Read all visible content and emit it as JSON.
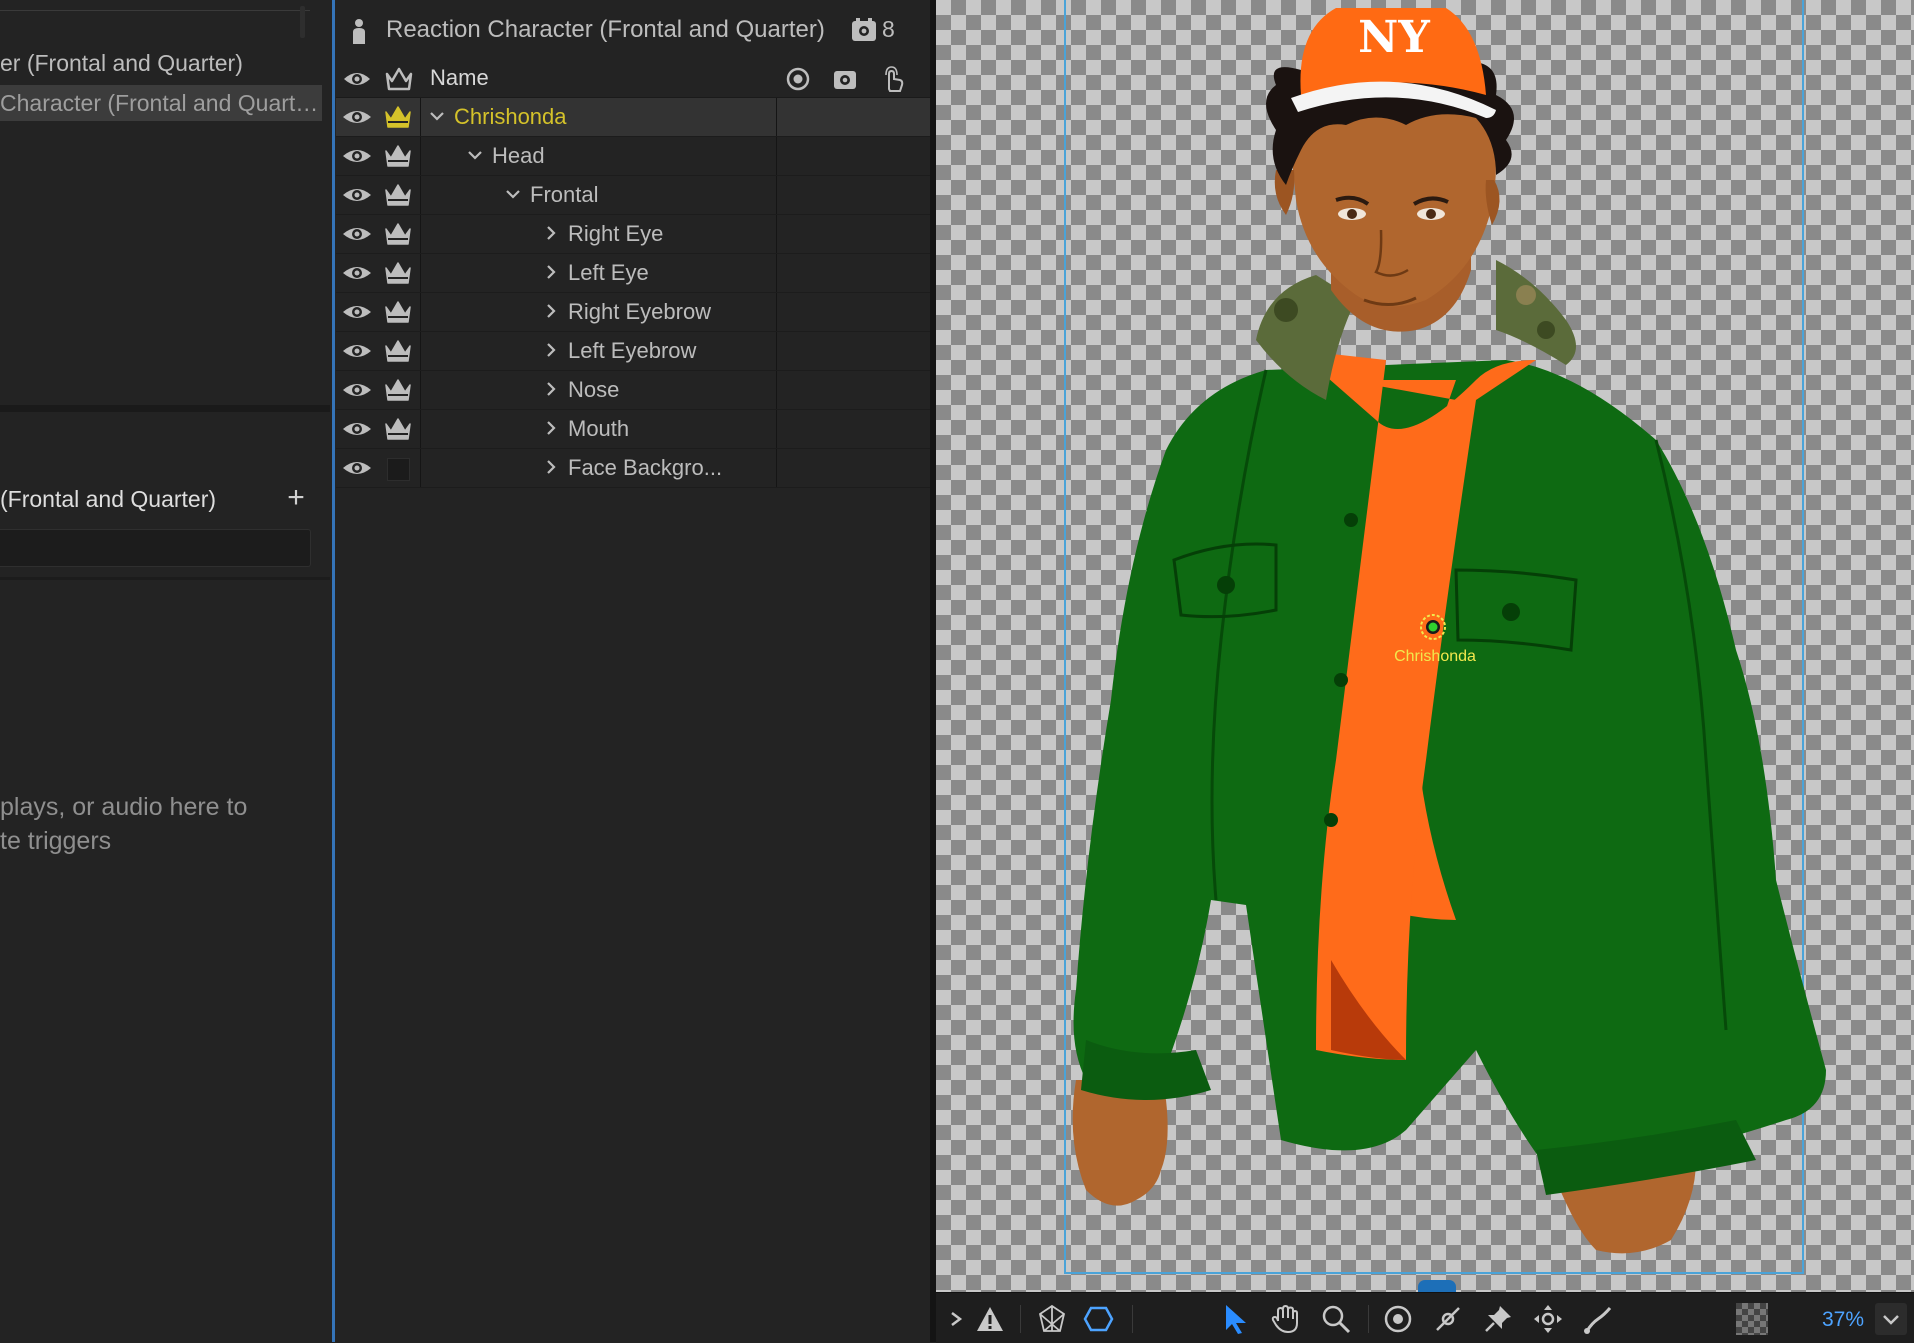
{
  "left_panel": {
    "puppet_items": [
      "er (Frontal and Quarter)",
      "Character (Frontal and Quart…"
    ],
    "trigger_title": "(Frontal and Quarter)",
    "add_button": "+",
    "drop_hint": "plays, or audio here to\nte triggers"
  },
  "layers_panel": {
    "title": "Reaction Character (Frontal and Quarter)",
    "count": "8",
    "column_name": "Name",
    "rows": [
      {
        "label": "Chrishonda",
        "depth": 0,
        "chevron": "down",
        "selected": true,
        "crown": true
      },
      {
        "label": "Head",
        "depth": 1,
        "chevron": "down",
        "crown": true
      },
      {
        "label": "Frontal",
        "depth": 2,
        "chevron": "down",
        "crown": true
      },
      {
        "label": "Right Eye",
        "depth": 3,
        "chevron": "right",
        "crown": true
      },
      {
        "label": "Left Eye",
        "depth": 3,
        "chevron": "right",
        "crown": true
      },
      {
        "label": "Right Eyebrow",
        "depth": 3,
        "chevron": "right",
        "crown": true
      },
      {
        "label": "Left Eyebrow",
        "depth": 3,
        "chevron": "right",
        "crown": true
      },
      {
        "label": "Nose",
        "depth": 3,
        "chevron": "right",
        "crown": true
      },
      {
        "label": "Mouth",
        "depth": 3,
        "chevron": "right",
        "crown": true
      },
      {
        "label": "Face Backgro...",
        "depth": 3,
        "chevron": "right",
        "crown": false
      }
    ]
  },
  "canvas": {
    "origin_label": "Chrishonda",
    "colors": {
      "artboard_border": "#4aa3d8",
      "selection": "#d4c22a",
      "jacket": "#0f6e12",
      "shirt": "#ff6b1a",
      "cap": "#ff6a13"
    }
  },
  "toolbar": {
    "zoom": "37%",
    "icons": [
      "expand-chevron-icon",
      "warning-icon",
      "mesh-icon",
      "outline-icon",
      "select-arrow-icon",
      "hand-icon",
      "zoom-icon",
      "origin-icon",
      "handle-icon",
      "pin-icon",
      "dragger-icon",
      "stick-icon",
      "transparency-grid-icon",
      "zoom-dropdown-icon"
    ]
  }
}
